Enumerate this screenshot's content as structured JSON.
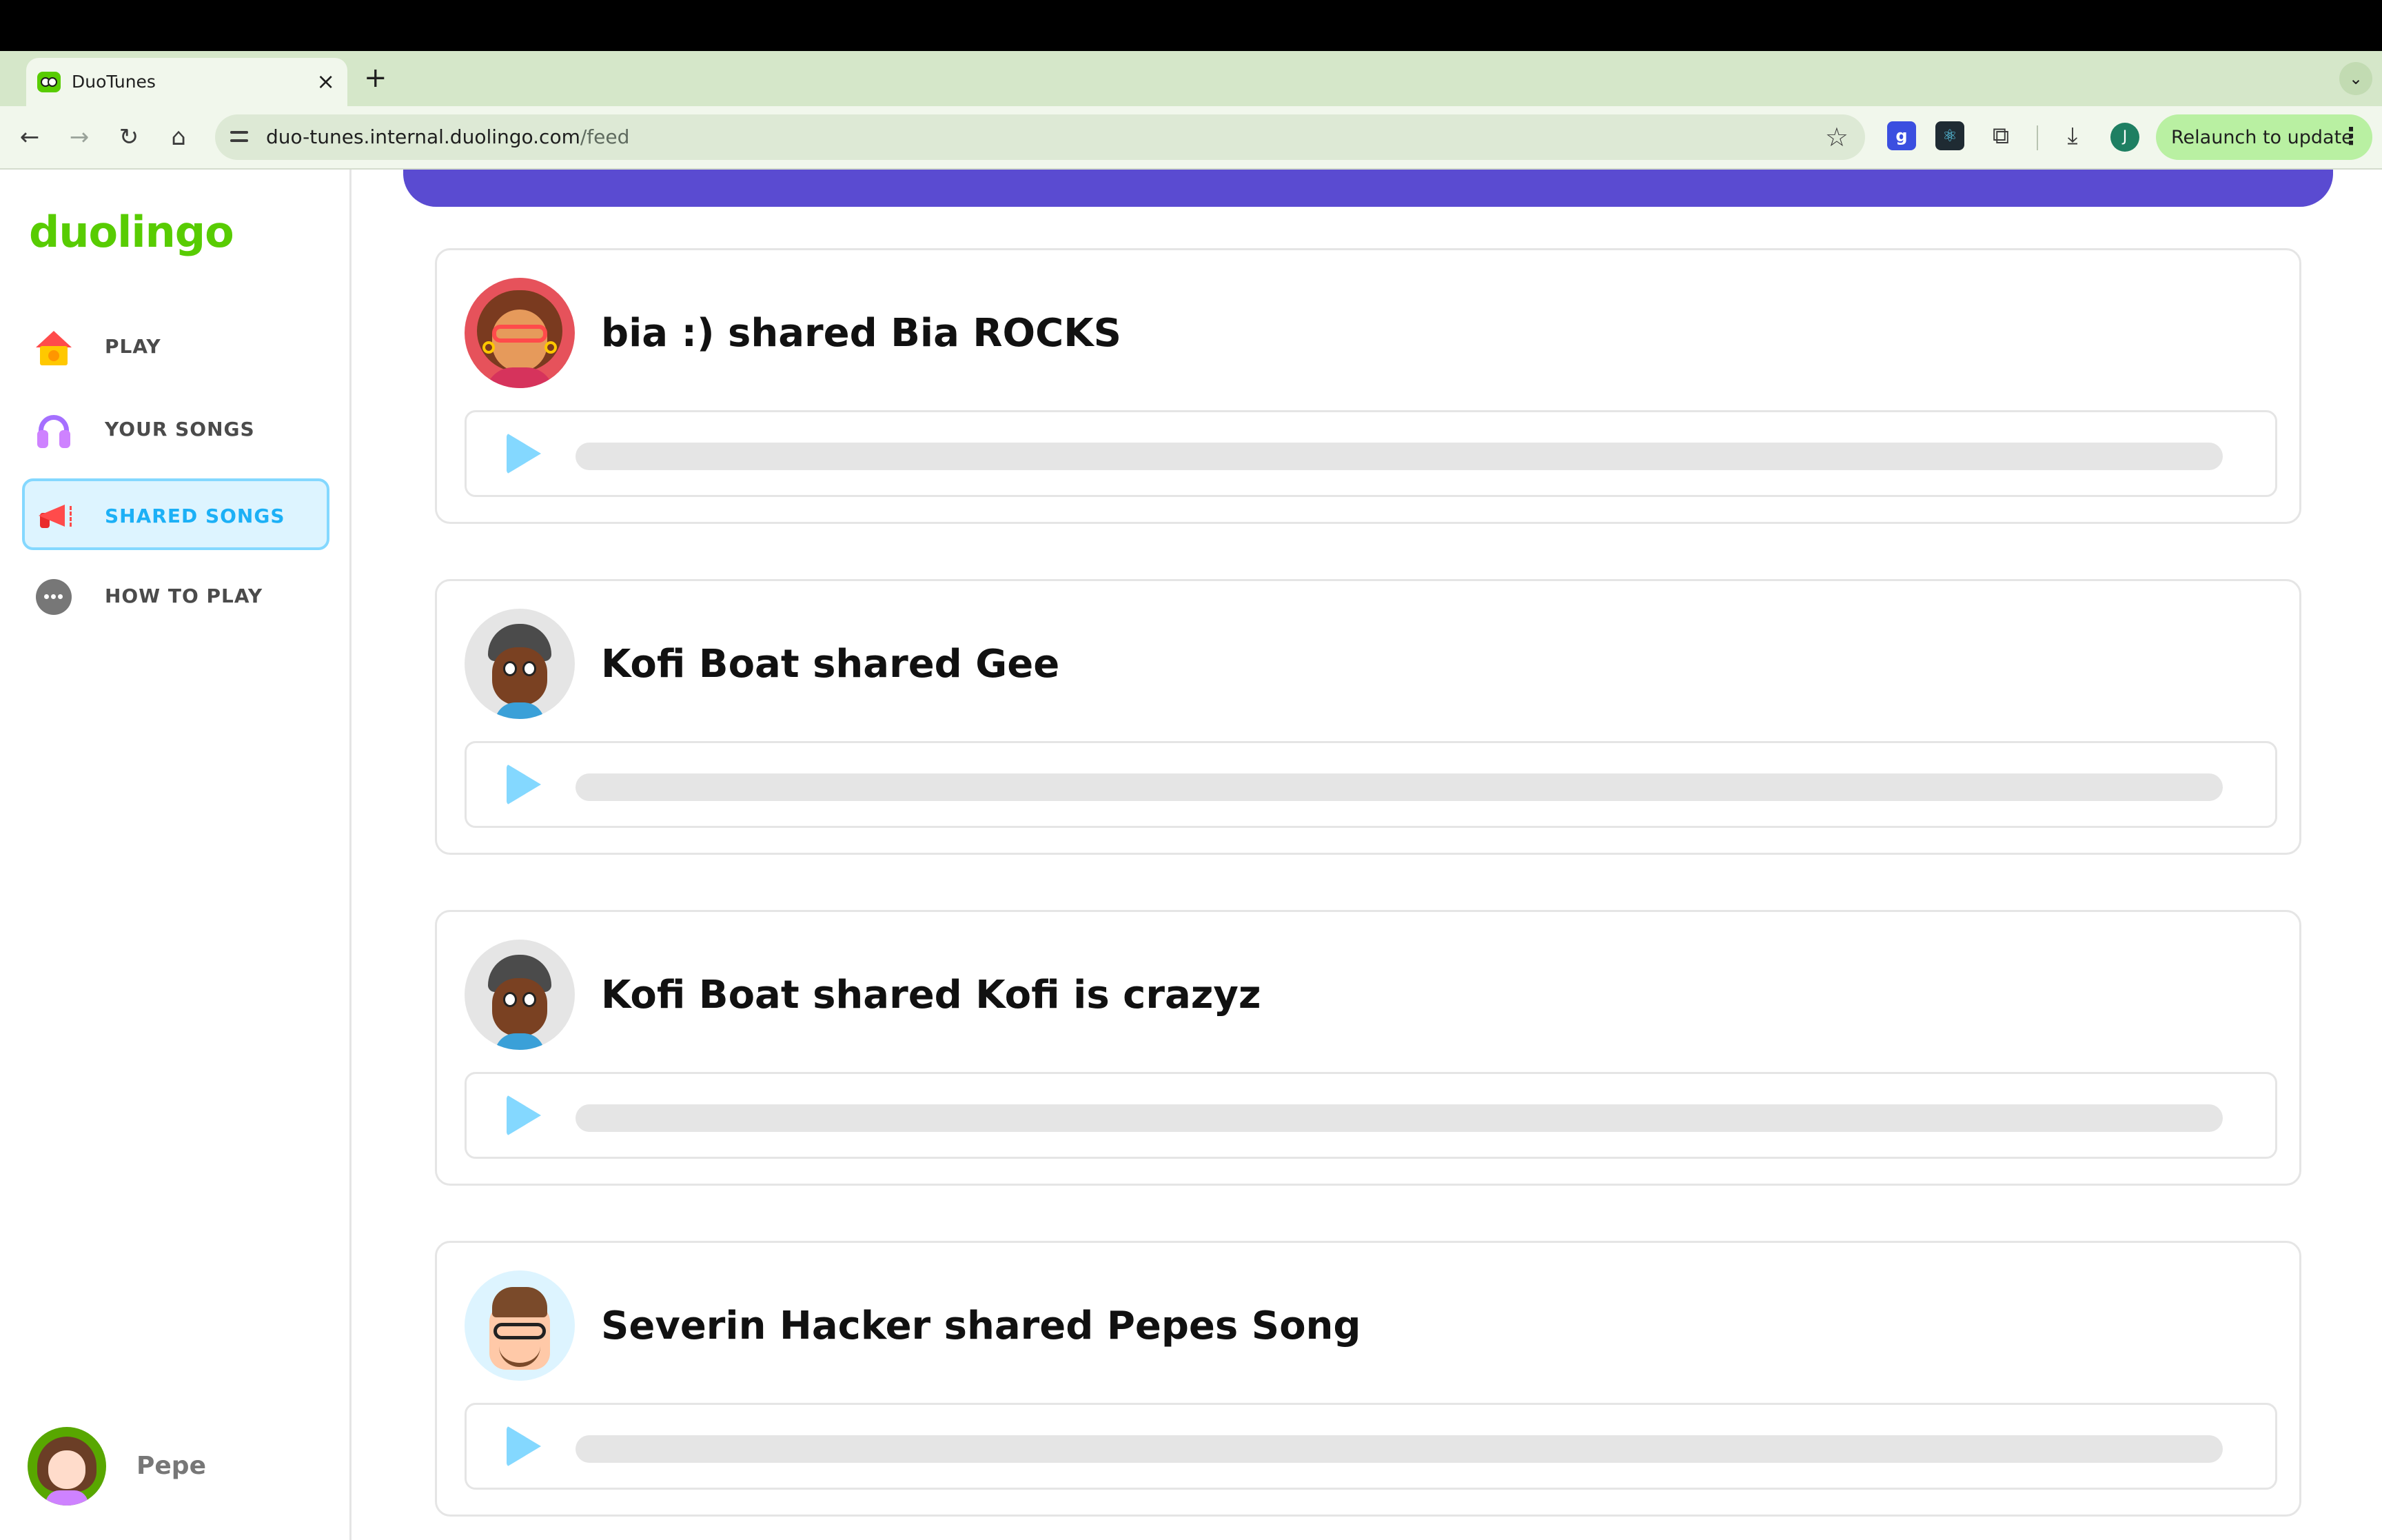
{
  "browser": {
    "tab_title": "DuoTunes",
    "tab_close": "×",
    "new_tab": "+",
    "tab_dropdown": "⌄",
    "url_host": "duo-tunes.internal.duolingo.com",
    "url_path": "/feed",
    "back": "←",
    "forward": "→",
    "reload": "↻",
    "home": "⌂",
    "star": "☆",
    "ext_g": "g",
    "ext_react": "⚛",
    "ext_puzzle": "⧉",
    "download": "⤓",
    "profile_initial": "J",
    "relaunch_label": "Relaunch to update",
    "relaunch_menu": "⋮"
  },
  "sidebar": {
    "logo": "duolingo",
    "items": [
      {
        "label": "PLAY",
        "icon": "house-icon",
        "active": false
      },
      {
        "label": "YOUR SONGS",
        "icon": "headphones-icon",
        "active": false
      },
      {
        "label": "SHARED SONGS",
        "icon": "megaphone-icon",
        "active": true
      },
      {
        "label": "HOW TO PLAY",
        "icon": "more-dots-icon",
        "active": false
      }
    ],
    "user": {
      "name": "Pepe"
    }
  },
  "feed": {
    "items": [
      {
        "title": "bia :) shared Bia ROCKS",
        "avatar": "bia-avatar"
      },
      {
        "title": "Kofi Boat shared Gee",
        "avatar": "kofi-avatar"
      },
      {
        "title": "Kofi Boat shared Kofi is crazyz",
        "avatar": "kofi-avatar"
      },
      {
        "title": "Severin Hacker shared Pepes Song",
        "avatar": "severin-avatar"
      }
    ]
  },
  "colors": {
    "brand_green": "#58cc02",
    "active_blue": "#1cb0f6",
    "active_bg": "#ddf4ff",
    "banner_purple": "#5a4bd1",
    "play_blue": "#84d8ff"
  }
}
